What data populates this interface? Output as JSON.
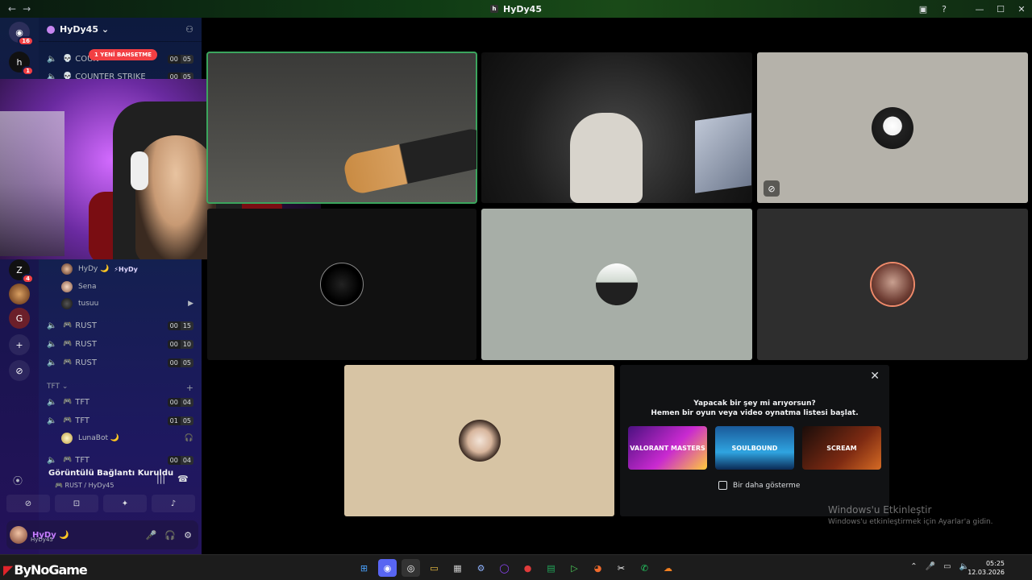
{
  "titlebar": {
    "back": "←",
    "forward": "→",
    "title": "HyDy45",
    "icons": [
      "inbox-icon",
      "help-icon"
    ],
    "window_controls": [
      "—",
      "☐",
      "✕"
    ]
  },
  "rail": {
    "dm_badge": "16",
    "server1_badge": "1",
    "server2_badge": "4",
    "add_label": "+",
    "discover_label": "⊘"
  },
  "server": {
    "name": "HyDy45 ⌄"
  },
  "mention_pill": "1 YENİ BAHSETME",
  "channels_top": [
    {
      "name": "COUN",
      "emoji": "💀",
      "count_a": "00",
      "count_b": "05"
    },
    {
      "name": "COUNTER STRIKE",
      "emoji": "💀",
      "count_a": "00",
      "count_b": "05"
    }
  ],
  "voice_users": [
    {
      "name": "HyDy 🌙",
      "tag": "⚡HyDy"
    },
    {
      "name": "Sena",
      "tag": ""
    },
    {
      "name": "tusuu",
      "tag": ""
    }
  ],
  "rust_channels": [
    {
      "name": "RUST",
      "emoji": "🎮",
      "count_a": "00",
      "count_b": "15"
    },
    {
      "name": "RUST",
      "emoji": "🎮",
      "count_a": "00",
      "count_b": "10"
    },
    {
      "name": "RUST",
      "emoji": "🎮",
      "count_a": "00",
      "count_b": "05"
    }
  ],
  "tft_category": "TFT ⌄",
  "tft_channels": [
    {
      "name": "TFT",
      "emoji": "🎮",
      "count_a": "00",
      "count_b": "04"
    },
    {
      "name": "TFT",
      "emoji": "🎮",
      "count_a": "01",
      "count_b": "05"
    },
    {
      "name": "TFT",
      "emoji": "🎮",
      "count_a": "00",
      "count_b": "04"
    }
  ],
  "tft_user": {
    "name": "LunaBot 🌙"
  },
  "voice_panel": {
    "status": "Görüntülü Bağlantı Kuruldu",
    "location": "🎮 RUST / HyDy45"
  },
  "user_panel": {
    "name": "HyDy 🌙",
    "status": "HyDy45"
  },
  "activity": {
    "close": "✕",
    "heading": "Yapacak bir şey mi arıyorsun?",
    "subheading": "Hemen bir oyun veya video oynatma listesi başlat.",
    "games": [
      "VALORANT MASTERS",
      "SOULBOUND",
      "SCREAM"
    ],
    "dont_show": "Bir daha gösterme"
  },
  "watermark": {
    "title": "Windows'u Etkinleştir",
    "subtitle": "Windows'u etkinleştirmek için Ayarlar'a gidin."
  },
  "taskbar": {
    "brand": "ByNoGame",
    "time": "05:25",
    "date": "12.03.2026"
  },
  "colors": {
    "accent_green": "#3ba55d",
    "badge_red": "#f23f43",
    "username_purple": "#c77dff"
  }
}
